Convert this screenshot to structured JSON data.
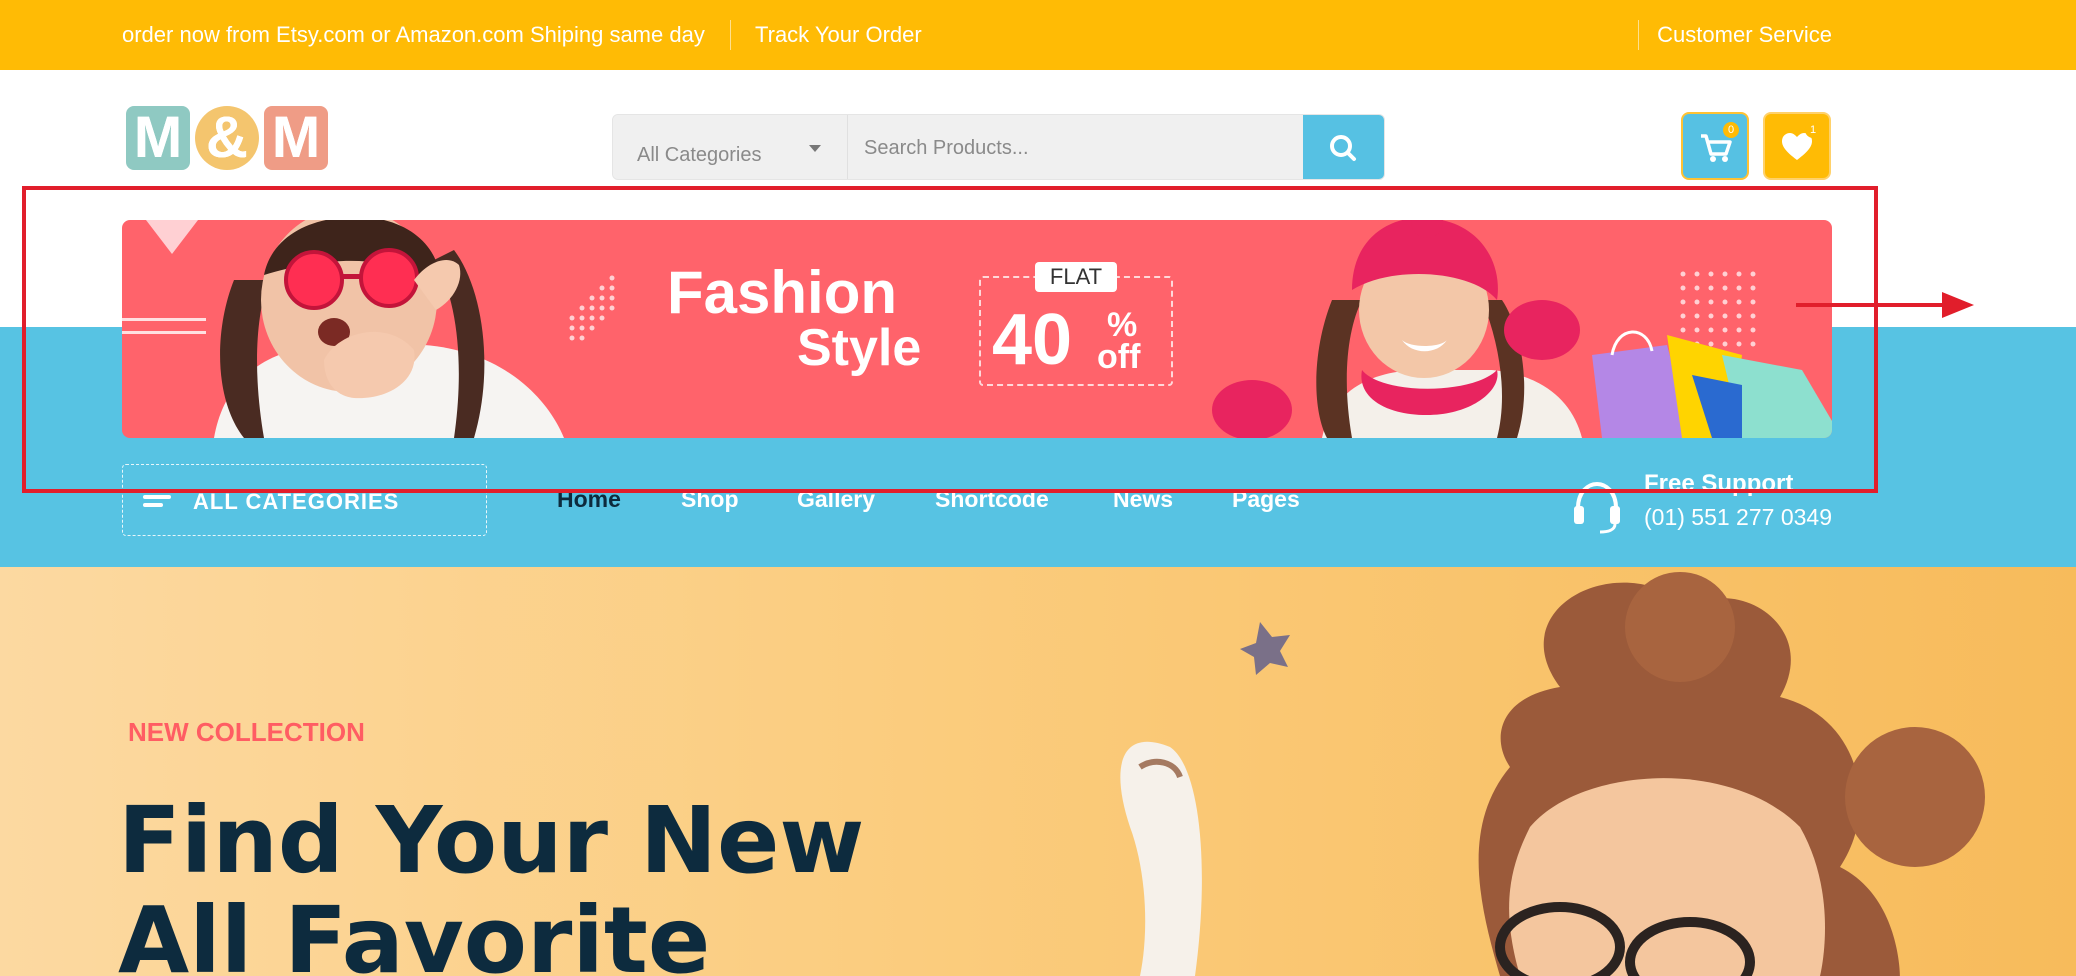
{
  "topbar": {
    "promo": "order now from Etsy.com or Amazon.com Shiping same day",
    "track_order": "Track Your Order",
    "customer_service": "Customer Service"
  },
  "logo": {
    "letters": [
      "M",
      "&",
      "M"
    ]
  },
  "search": {
    "category_label": "All Categories",
    "placeholder": "Search Products..."
  },
  "header_icons": {
    "cart_count": "0",
    "wishlist_count": "1"
  },
  "nav": {
    "all_categories": "ALL CATEGORIES",
    "items": [
      "Home",
      "Shop",
      "Gallery",
      "Shortcode",
      "News",
      "Pages"
    ],
    "active": "Home"
  },
  "support": {
    "title": "Free Support",
    "phone": "(01) 551 277 0349"
  },
  "banner": {
    "line1": "Fashion",
    "line2": "Style",
    "flat": "FLAT",
    "amount": "40",
    "percent": "%",
    "off": "off"
  },
  "hero": {
    "kicker": "NEW COLLECTION",
    "title_line1": "Find Your New",
    "title_line2": "All Favorite"
  },
  "colors": {
    "topbar": "#ffbb05",
    "nav_band": "#57c3e3",
    "banner": "#ff636b",
    "annotation": "#e11e2b",
    "hero_text": "#0d2b3e"
  }
}
